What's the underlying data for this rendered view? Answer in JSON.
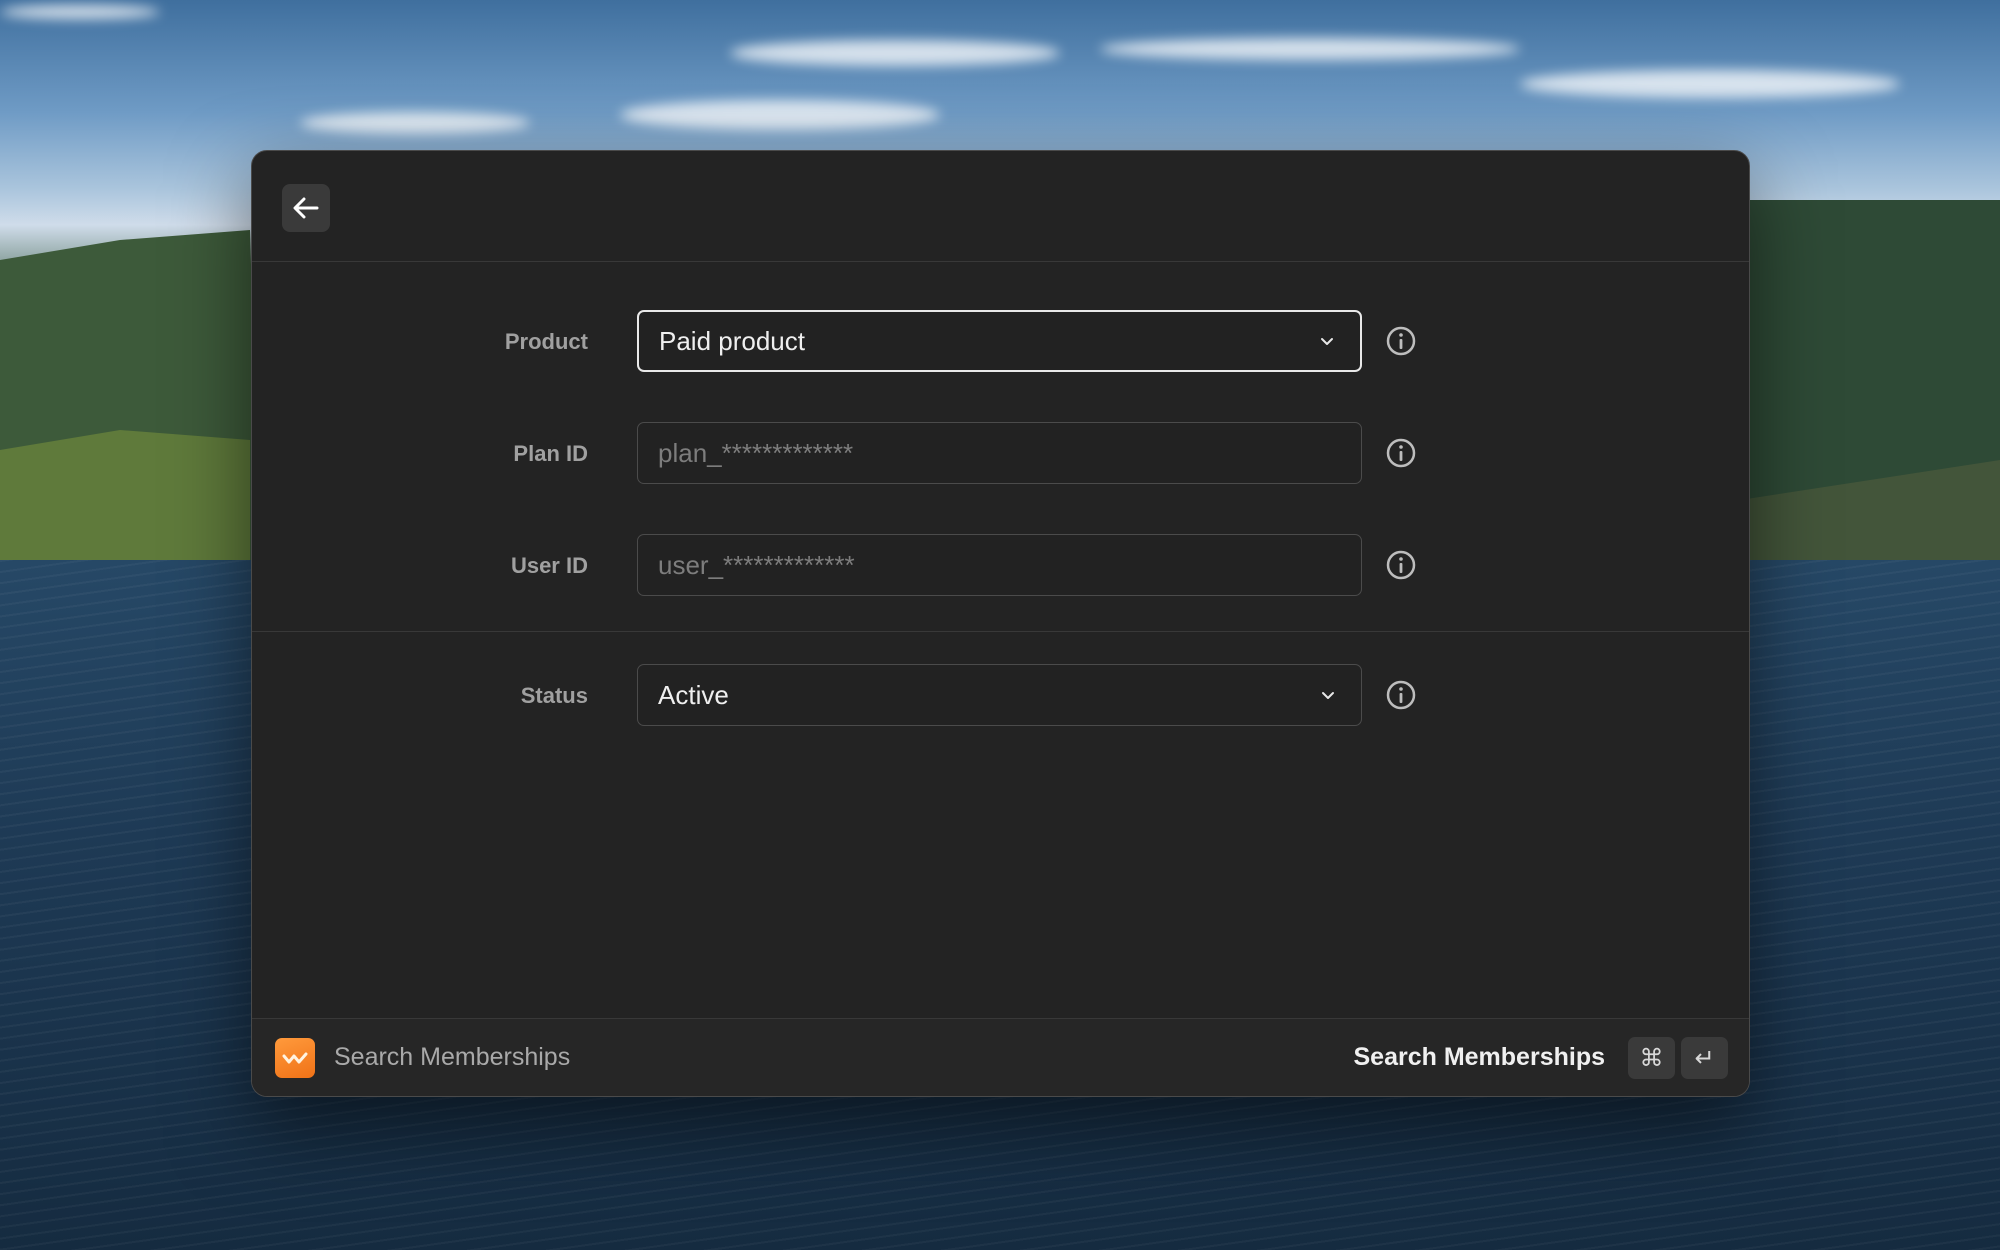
{
  "form": {
    "product": {
      "label": "Product",
      "value": "Paid product"
    },
    "plan_id": {
      "label": "Plan ID",
      "placeholder": "plan_*************",
      "value": ""
    },
    "user_id": {
      "label": "User ID",
      "placeholder": "user_*************",
      "value": ""
    },
    "status": {
      "label": "Status",
      "value": "Active"
    }
  },
  "footer": {
    "command_title": "Search Memberships",
    "primary_action": "Search Memberships",
    "shortcut_keys": [
      "⌘",
      "↵"
    ]
  },
  "colors": {
    "window_bg": "#232323",
    "focus_border": "#e9e9e9",
    "app_icon": "#f07217"
  },
  "icons": {
    "back": "arrow-left-icon",
    "info": "info-circle-icon",
    "dropdown": "chevron-down-icon",
    "app": "whop-logo-icon"
  }
}
